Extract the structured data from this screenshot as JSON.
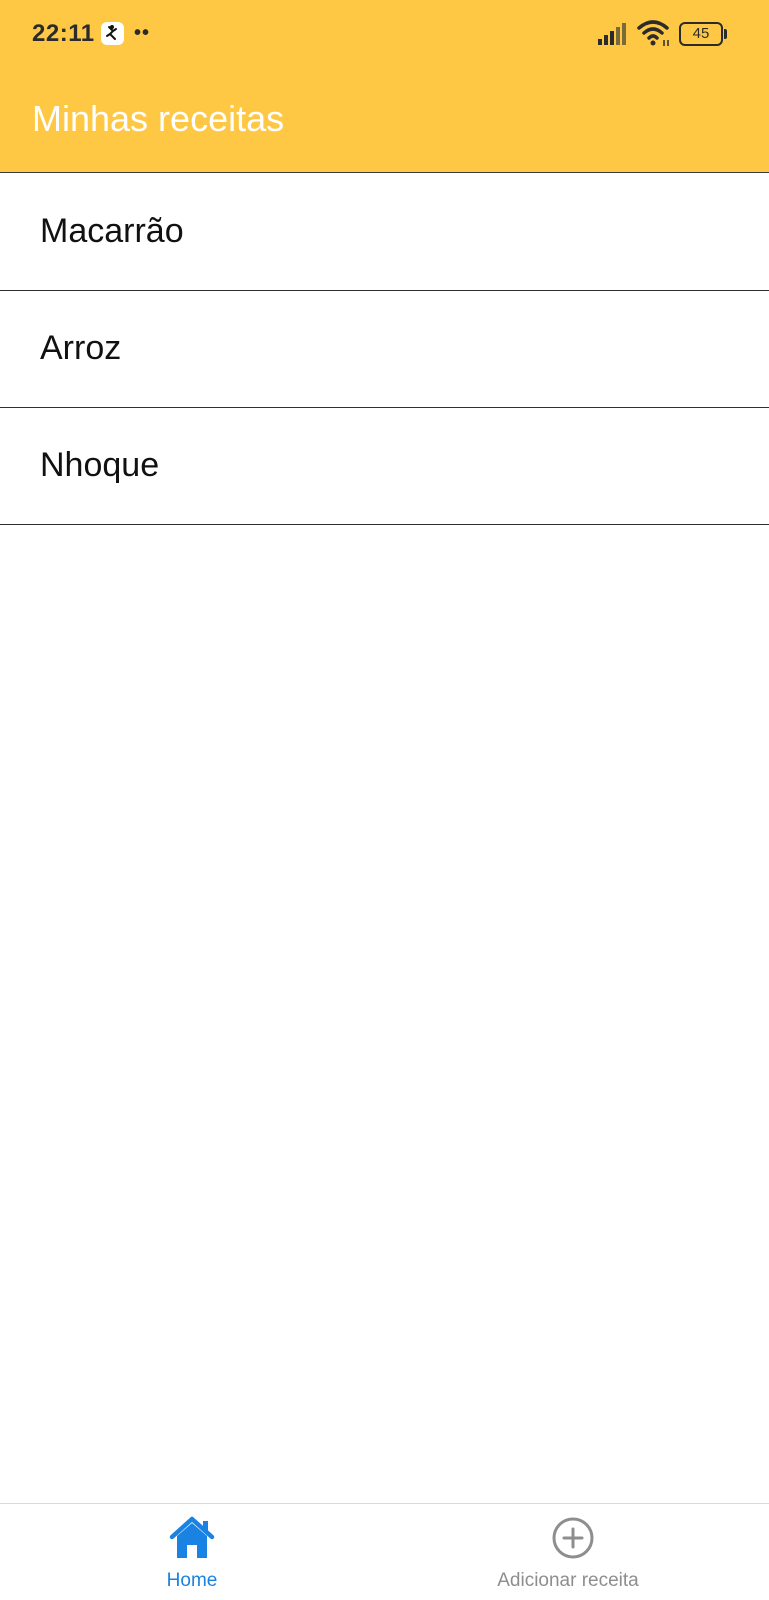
{
  "status_bar": {
    "time": "22:11",
    "notification_dots": "••",
    "battery_level": "45"
  },
  "app_bar": {
    "title": "Minhas receitas",
    "background_color": "#FFC844"
  },
  "recipes": [
    {
      "name": "Macarrão"
    },
    {
      "name": "Arroz"
    },
    {
      "name": "Nhoque"
    }
  ],
  "tab_bar": {
    "active_color": "#1a82e2",
    "inactive_color": "#8e8e8e",
    "tabs": [
      {
        "label": "Home",
        "icon": "home-icon",
        "active": true
      },
      {
        "label": "Adicionar receita",
        "icon": "add-circle-icon",
        "active": false
      }
    ]
  }
}
